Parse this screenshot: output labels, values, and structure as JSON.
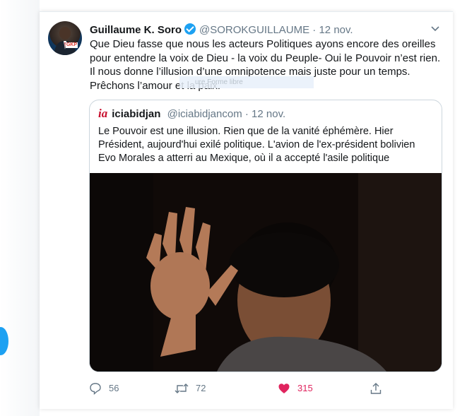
{
  "tweet": {
    "author_name": "Guillaume K. Soro",
    "handle": "@SOROKGUILLAUME",
    "separator": "·",
    "date": "12 nov.",
    "text": "Que Dieu fasse que nous les acteurs Politiques ayons encore des oreilles pour entendre la voix de Dieu - la voix du Peuple- Oui le Pouvoir n’est rien. Il nous donne l’illusion d’une omnipotence mais juste pour un temps. Prêchons l’amour et la paix.",
    "avatar_badge": "GKP",
    "overlay_text": "ure Forme libre"
  },
  "quote": {
    "logo": "ia",
    "author_name": "iciabidjan",
    "handle": "@iciabidjancom",
    "separator": "·",
    "date": "12 nov.",
    "text": "Le Pouvoir est une illusion. Rien que de la vanité éphémère. Hier Président, aujourd'hui exilé politique. L'avion de l'ex-président bolivien Evo Morales a atterri au Mexique, où il a accepté l'asile politique"
  },
  "actions": {
    "replies": "56",
    "retweets": "72",
    "likes": "315"
  },
  "colors": {
    "accent": "#1da1f2",
    "like": "#e0245e",
    "muted": "#657786",
    "logo_red": "#c8102e"
  },
  "icons": [
    "verified-icon",
    "chevron-down-icon",
    "reply-icon",
    "retweet-icon",
    "heart-icon",
    "share-icon"
  ]
}
